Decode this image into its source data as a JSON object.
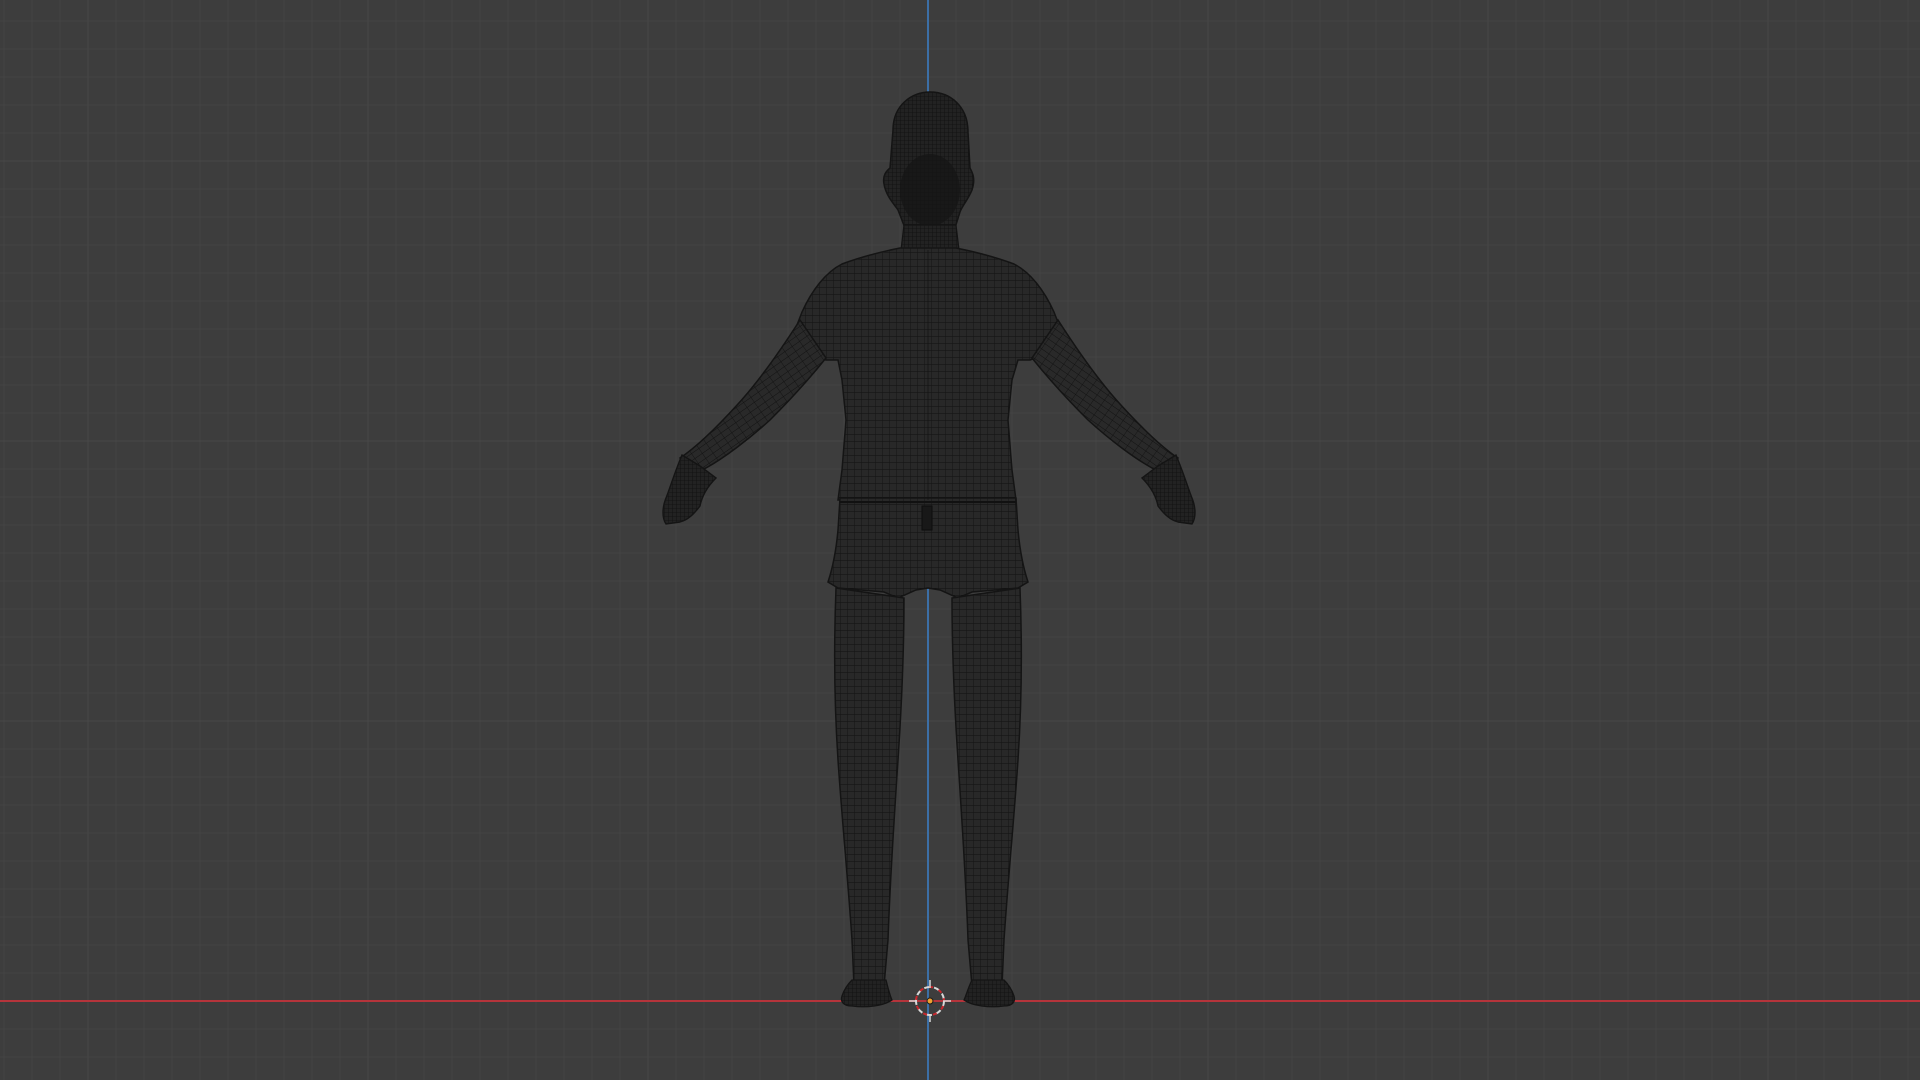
{
  "viewport": {
    "background_color": "#3d3d3d",
    "grid_minor_color": "#434343",
    "grid_major_color": "#484848",
    "axis_x_color": "#b5343b",
    "axis_z_color": "#3c6fa6",
    "mesh_fill_color": "#262626",
    "wire_color": "#141414",
    "cursor_ring_colors": [
      "#d8d8d8",
      "#c8272d"
    ],
    "icons": {
      "cursor": "3d-cursor-icon",
      "origin": "object-origin-icon"
    }
  }
}
